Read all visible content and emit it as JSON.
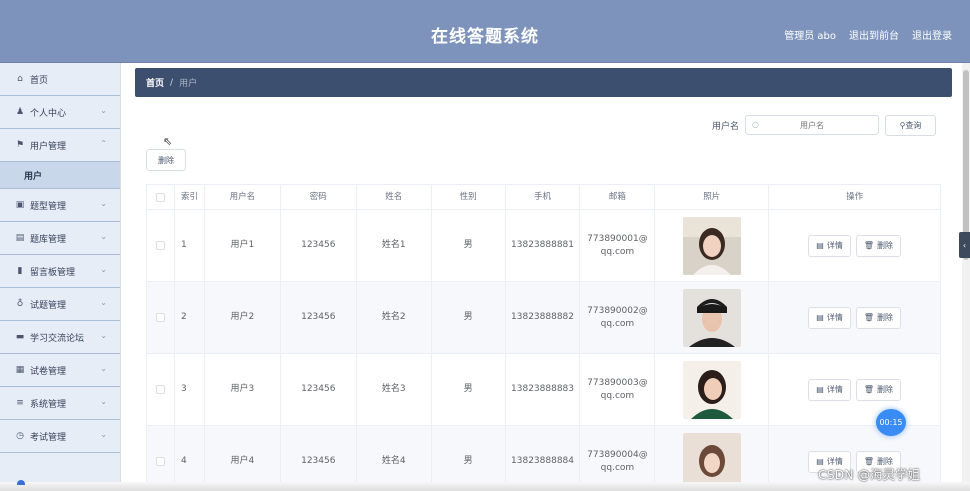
{
  "header": {
    "title": "在线答题系统",
    "admin": "管理员 abo",
    "back_to_front": "退出到前台",
    "logout": "退出登录"
  },
  "sidebar": {
    "items": [
      {
        "label": "首页",
        "icon": "home-icon",
        "glyph": "⌂",
        "chevron": ""
      },
      {
        "label": "个人中心",
        "icon": "user-icon",
        "glyph": "♟",
        "chevron": "⌄"
      },
      {
        "label": "用户管理",
        "icon": "flag-icon",
        "glyph": "⚑",
        "chevron": "⌃"
      },
      {
        "label": "用户",
        "sub": true
      },
      {
        "label": "题型管理",
        "icon": "box-icon",
        "glyph": "▣",
        "chevron": "⌄"
      },
      {
        "label": "题库管理",
        "icon": "folder-icon",
        "glyph": "▤",
        "chevron": "⌄"
      },
      {
        "label": "留言板管理",
        "icon": "chart-icon",
        "glyph": "▮",
        "chevron": "⌄"
      },
      {
        "label": "试题管理",
        "icon": "mic-icon",
        "glyph": "♁",
        "chevron": "⌄"
      },
      {
        "label": "学习交流论坛",
        "icon": "chat-icon",
        "glyph": "▬",
        "chevron": "⌄"
      },
      {
        "label": "试卷管理",
        "icon": "doc-icon",
        "glyph": "▦",
        "chevron": "⌄"
      },
      {
        "label": "系统管理",
        "icon": "list-icon",
        "glyph": "≡",
        "chevron": "⌄"
      },
      {
        "label": "考试管理",
        "icon": "clock-icon",
        "glyph": "◷",
        "chevron": "⌄"
      }
    ]
  },
  "breadcrumb": {
    "home": "首页",
    "sep": "/",
    "current": "用户"
  },
  "search": {
    "label": "用户名",
    "placeholder": "用户名",
    "button": "查询",
    "mag": "○"
  },
  "toolbar": {
    "delete": "删除"
  },
  "table": {
    "headers": [
      "",
      "索引",
      "用户名",
      "密码",
      "姓名",
      "性别",
      "手机",
      "邮箱",
      "照片",
      "操作"
    ],
    "rows": [
      {
        "index": "1",
        "username": "用户1",
        "password": "123456",
        "name": "姓名1",
        "gender": "男",
        "phone": "13823888881",
        "email": "773890001@qq.com"
      },
      {
        "index": "2",
        "username": "用户2",
        "password": "123456",
        "name": "姓名2",
        "gender": "男",
        "phone": "13823888882",
        "email": "773890002@qq.com"
      },
      {
        "index": "3",
        "username": "用户3",
        "password": "123456",
        "name": "姓名3",
        "gender": "男",
        "phone": "13823888883",
        "email": "773890003@qq.com"
      },
      {
        "index": "4",
        "username": "用户4",
        "password": "123456",
        "name": "姓名4",
        "gender": "男",
        "phone": "13823888884",
        "email": "773890004@qq.com"
      }
    ],
    "detail_label": "详情",
    "delete_label": "删除"
  },
  "timer": "00:15",
  "watermark": "CSDN @海灵学姐",
  "side_tab": "‹",
  "colors": {
    "header": "#7d93bc",
    "breadcrumb": "#3d4f6e",
    "sidebar": "#e6edf7",
    "accent": "#3a8cf5"
  }
}
